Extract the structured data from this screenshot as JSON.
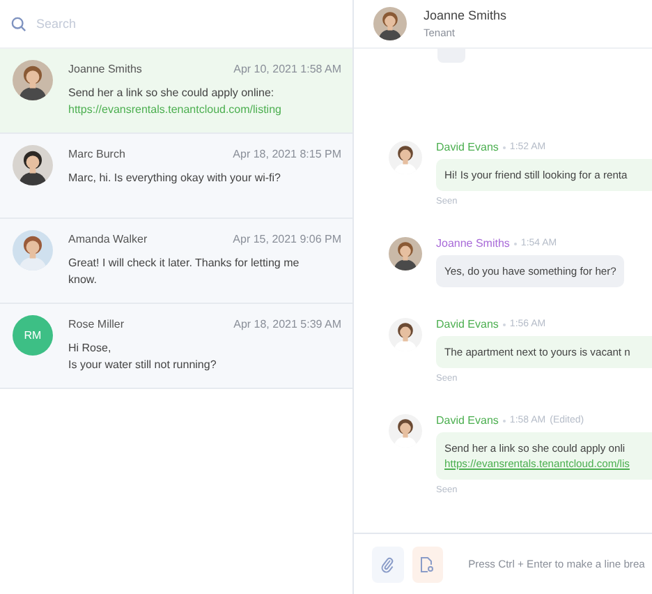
{
  "search": {
    "placeholder": "Search"
  },
  "conversations": [
    {
      "name": "Joanne Smiths",
      "date": "Apr 10, 2021 1:58 AM",
      "avatar": {
        "kind": "picture"
      },
      "lines": [
        "Send her a link so she could apply online:"
      ],
      "link": "https://evansrentals.tenantcloud.com/listing",
      "selected": true
    },
    {
      "name": "Marc Burch",
      "date": "Apr 18, 2021 8:15 PM",
      "avatar": {
        "kind": "picture"
      },
      "lines": [
        "Marc, hi. Is everything okay with your wi-fi?"
      ],
      "selected": false
    },
    {
      "name": "Amanda Walker",
      "date": "Apr 15, 2021 9:06 PM",
      "avatar": {
        "kind": "picture"
      },
      "lines": [
        "Great! I will check it later. Thanks for letting me know."
      ],
      "selected": false
    },
    {
      "name": "Rose Miller",
      "date": "Apr 18, 2021 5:39 AM",
      "avatar": {
        "kind": "initials",
        "initials": "RM",
        "color": "#3dbf85"
      },
      "lines": [
        "Hi Rose,",
        "Is your water still not running?"
      ],
      "selected": false
    }
  ],
  "chat_header": {
    "name": "Joanne Smiths",
    "role": "Tenant"
  },
  "messages": [
    {
      "kind": "cut"
    },
    {
      "kind": "outgoing",
      "author": "David Evans",
      "time": "1:52 AM",
      "text": "Hi! Is your friend still looking for a renta",
      "status": "Seen"
    },
    {
      "kind": "incoming",
      "author": "Joanne Smiths",
      "time": "1:54 AM",
      "text": "Yes, do you have something for her?"
    },
    {
      "kind": "outgoing",
      "author": "David Evans",
      "time": "1:56 AM",
      "text": "The apartment next to yours is vacant n",
      "status": "Seen"
    },
    {
      "kind": "outgoing",
      "author": "David Evans",
      "time": "1:58 AM",
      "edited": "(Edited)",
      "text": "Send her a link so she could apply onli",
      "link": "https://evansrentals.tenantcloud.com/lis",
      "status": "Seen"
    }
  ],
  "composer": {
    "placeholder": "Press Ctrl + Enter to make a line brea"
  }
}
